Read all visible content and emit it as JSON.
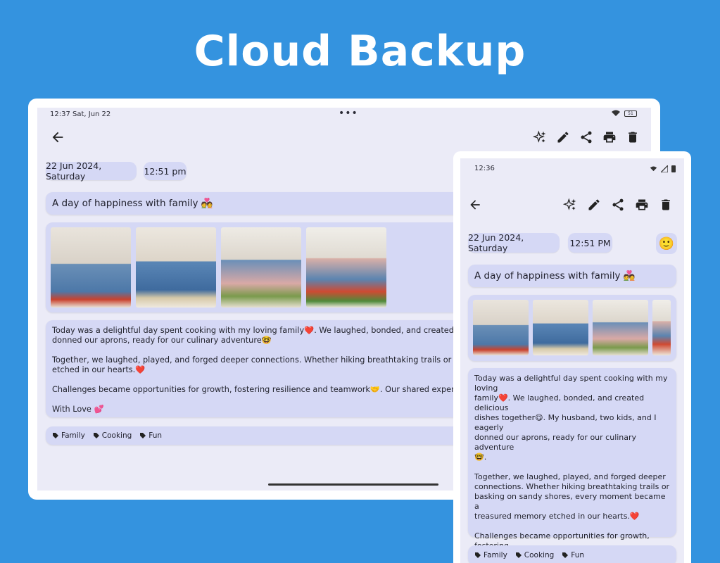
{
  "headline": "Cloud Backup",
  "tablet": {
    "status": {
      "time": "12:37  Sat, Jun 22",
      "dots": "•••",
      "battery": "51"
    },
    "date": "22 Jun 2024, Saturday",
    "time": "12:51 pm",
    "title": "A day of happiness with family 💑",
    "body": "Today was a delightful day spent cooking with my loving family❤️. We laughed, bonded, and created delicious dishes to\ndonned our aprons, ready for our culinary adventure🤓\n\nTogether, we laughed, played, and forged deeper connections. Whether hiking breathtaking trails or basking on sandy s\netched in our hearts.❤️\n\nChallenges became opportunities for growth, fostering resilience and teamwork🤝. Our shared experiences strengthe\n\nWith Love 💕",
    "tags": [
      "Family",
      "Cooking",
      "Fun"
    ]
  },
  "phone": {
    "status": {
      "time": "12:36"
    },
    "date": "22 Jun 2024, Saturday",
    "time": "12:51 PM",
    "mood": "🙂",
    "title": "A day of happiness with family 💑",
    "body": "Today was a delightful day spent cooking with my loving\nfamily❤️. We laughed, bonded, and created delicious\ndishes together😋. My husband, two kids, and I eagerly\ndonned our aprons, ready for our culinary adventure\n🤓.\n\nTogether, we laughed, played, and forged deeper\nconnections. Whether hiking breathtaking trails or\nbasking on sandy shores, every moment became a\ntreasured memory etched in our hearts.❤️\n\nChallenges became opportunities for growth, fostering\nresilience and teamwork🤝. Our shared experiences\nstrengthened the bonds that held us together.\n\nWith Love 💕",
    "tags": [
      "Family",
      "Cooking",
      "Fun"
    ]
  },
  "icons": [
    "back-arrow-icon",
    "sparkle-icon",
    "pencil-icon",
    "share-icon",
    "print-icon",
    "trash-icon",
    "tag-icon",
    "wifi-icon",
    "battery-icon"
  ],
  "colors": {
    "background": "#3493df",
    "screen": "#ebebf7",
    "card": "#d5d8f5"
  }
}
